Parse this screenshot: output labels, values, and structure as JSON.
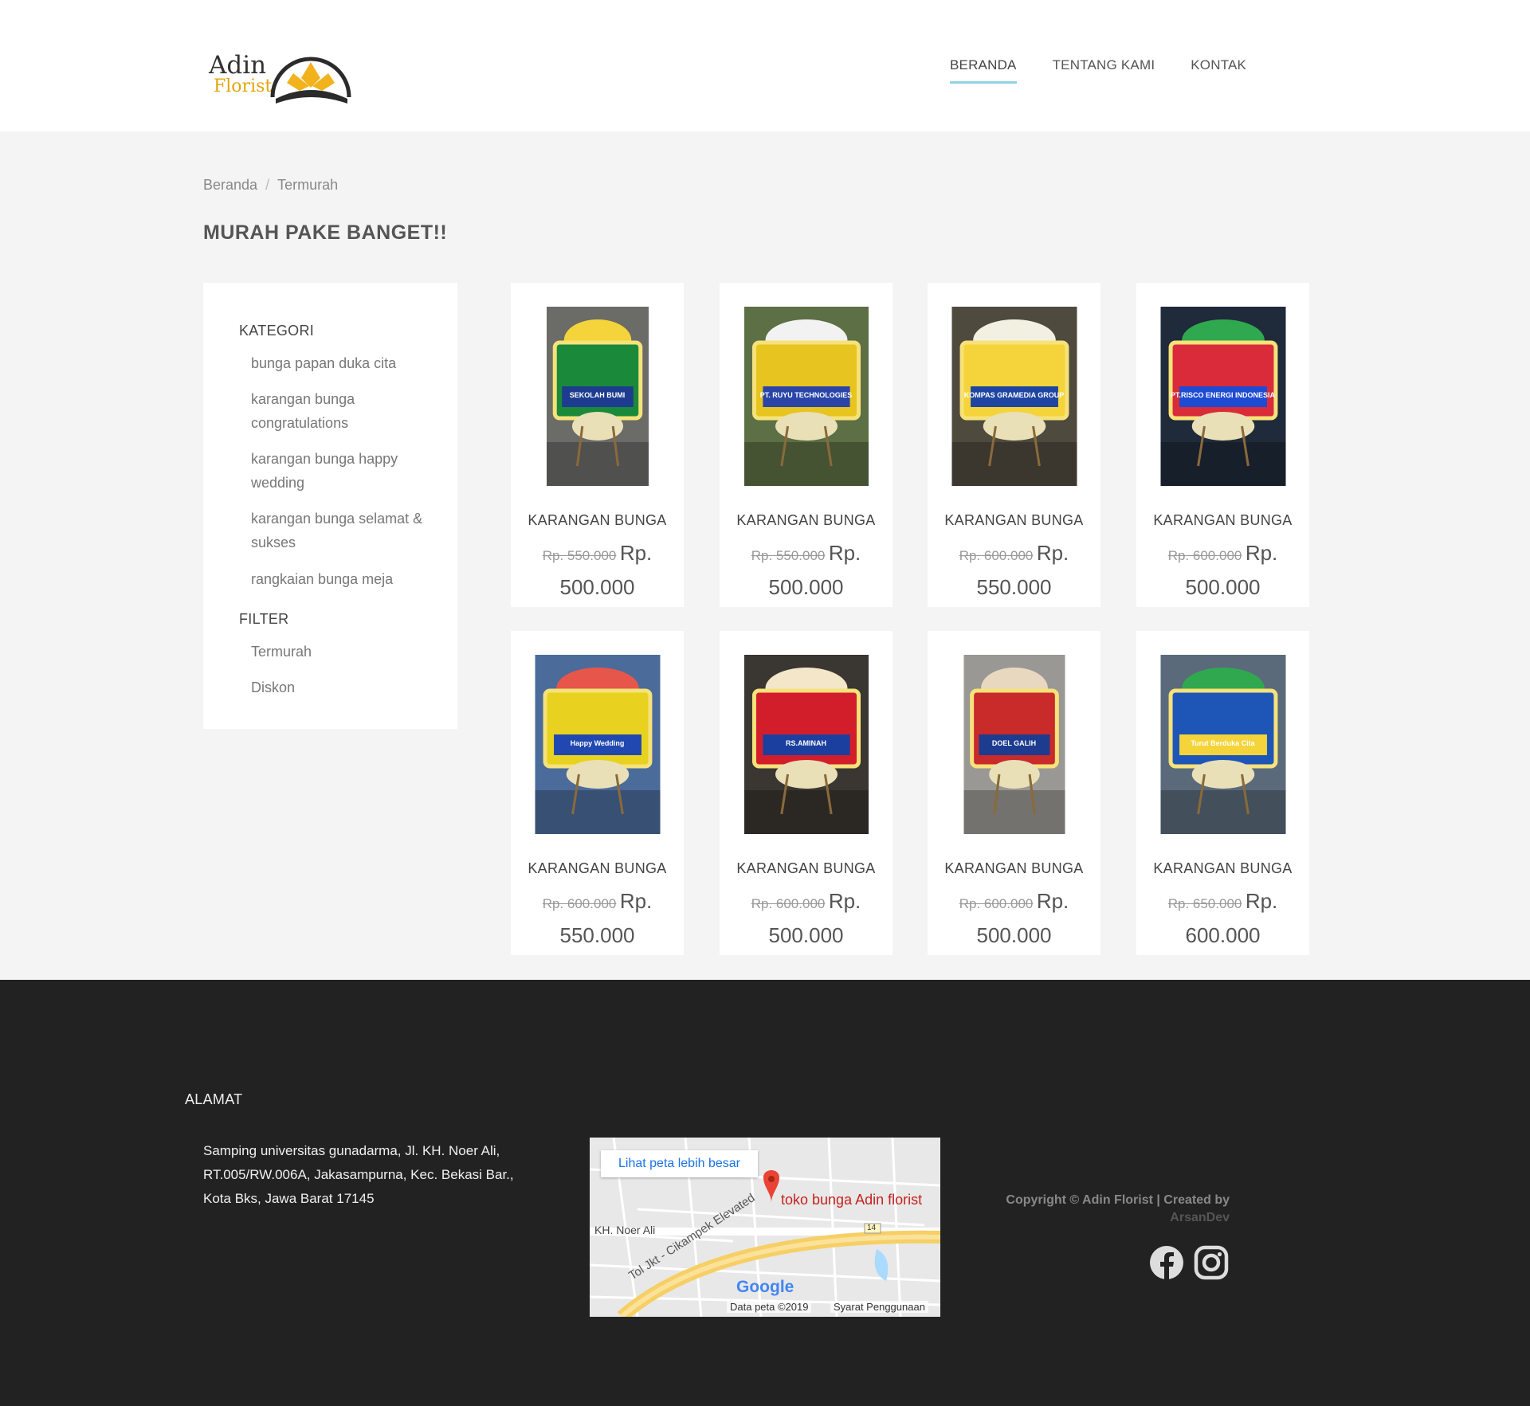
{
  "header": {
    "logo_line1": "Adin",
    "logo_line2": "Florist",
    "nav": [
      "BERANDA",
      "TENTANG KAMI",
      "KONTAK"
    ]
  },
  "breadcrumb": {
    "home": "Beranda",
    "sep": "/",
    "current": "Termurah"
  },
  "page_title": "MURAH PAKE BANGET!!",
  "sidebar": {
    "kategori_heading": "KATEGORI",
    "kategori": [
      "bunga papan duka cita",
      "karangan bunga congratulations",
      "karangan bunga happy wedding",
      "karangan bunga selamat & sukses",
      "rangkaian bunga meja"
    ],
    "filter_heading": "FILTER",
    "filter": [
      "Termurah",
      "Diskon"
    ]
  },
  "products": [
    {
      "name": "KARANGAN BUNGA",
      "old": "Rp. 550.000",
      "rp": "Rp.",
      "now": "500.000",
      "banner": "SEKOLAH BUMI"
    },
    {
      "name": "KARANGAN BUNGA",
      "old": "Rp. 550.000",
      "rp": "Rp.",
      "now": "500.000",
      "banner": "PT. RUYU TECHNOLOGIES"
    },
    {
      "name": "KARANGAN BUNGA",
      "old": "Rp. 600.000",
      "rp": "Rp.",
      "now": "550.000",
      "banner": "KOMPAS GRAMEDIA GROUP"
    },
    {
      "name": "KARANGAN BUNGA",
      "old": "Rp. 600.000",
      "rp": "Rp.",
      "now": "500.000",
      "banner": "PT.RISCO ENERGI INDONESIA"
    },
    {
      "name": "KARANGAN BUNGA",
      "old": "Rp. 600.000",
      "rp": "Rp.",
      "now": "550.000",
      "banner": "Happy Wedding"
    },
    {
      "name": "KARANGAN BUNGA",
      "old": "Rp. 600.000",
      "rp": "Rp.",
      "now": "500.000",
      "banner": "RS.AMINAH"
    },
    {
      "name": "KARANGAN BUNGA",
      "old": "Rp. 600.000",
      "rp": "Rp.",
      "now": "500.000",
      "banner": "DOEL GALIH"
    },
    {
      "name": "KARANGAN BUNGA",
      "old": "Rp. 650.000",
      "rp": "Rp.",
      "now": "600.000",
      "banner": "Turut Berduka Cita"
    }
  ],
  "footer": {
    "heading": "ALAMAT",
    "address": "Samping universitas gunadarma, Jl. KH. Noer Ali, RT.005/RW.006A, Jakasampurna, Kec. Bekasi Bar., Kota Bks, Jawa Barat 17145",
    "map": {
      "button": "Lihat peta lebih besar",
      "place": "toko bunga Adin florist",
      "road1": "KH. Noer Ali",
      "road2": "Tol Jkt - Cikampek Elevated",
      "shield": "14",
      "brand": "Google",
      "data": "Data peta ©2019",
      "terms": "Syarat Penggunaan"
    },
    "copyright": "Copyright © Adin Florist | Created by",
    "author": "ArsanDev"
  }
}
